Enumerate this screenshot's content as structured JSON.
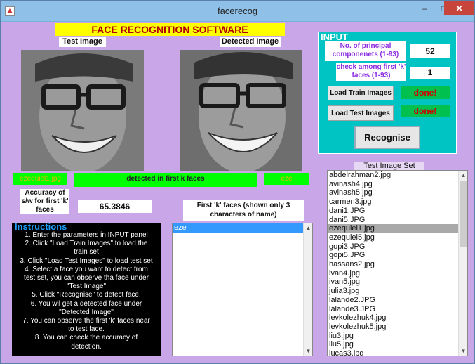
{
  "window": {
    "title": "facerecog"
  },
  "banner": "FACE RECOGNITION SOFTWARE",
  "test_image_label": "Test Image",
  "detected_image_label": "Detected Image",
  "test_filename": "ezequiel1.jpg",
  "detected_status": "detected in first k faces",
  "detected_name": "eze",
  "accuracy": {
    "label": "Accuracy of s/w for first 'k' faces",
    "value": "65.3846"
  },
  "first_k": {
    "label": "First 'k' faces (shown only 3 characters of name)",
    "items": [
      "eze"
    ]
  },
  "input_panel": {
    "title": "INPUT",
    "principal_label": "No. of principal componenets (1-93)",
    "principal_value": "52",
    "k_label": "check among first 'k' faces (1-93)",
    "k_value": "1",
    "load_train": "Load Train Images",
    "load_train_status": "done!",
    "load_test": "Load Test Images",
    "load_test_status": "done!",
    "recognise": "Recognise"
  },
  "test_set": {
    "label": "Test Image Set",
    "items": [
      "abdelrahman2.jpg",
      "avinash4.jpg",
      "avinash5.jpg",
      "carmen3.jpg",
      "dani1.JPG",
      "dani5.JPG",
      "ezequiel1.jpg",
      "ezequiel5.jpg",
      "gopi3.JPG",
      "gopi5.JPG",
      "hassans2.jpg",
      "ivan4.jpg",
      "ivan5.jpg",
      "julia3.jpg",
      "lalande2.JPG",
      "lalande3.JPG",
      "levkolezhuk4.jpg",
      "levkolezhuk5.jpg",
      "liu3.jpg",
      "liu5.jpg",
      "lucas3.jpg"
    ],
    "selected_index": 6
  },
  "instructions": {
    "title": "Instructions",
    "lines": [
      "1. Enter the parameters in INPUT panel",
      "2. Click \"Load Train Images\" to load the",
      "train set",
      "3. Click \"Load Test Images\" to load test set",
      "4. Select a face you want to detect from",
      "test set, you can observe tha face under",
      "\"Test Image\"",
      "5. Click \"Recognise\" to detect face.",
      "6. You wil get a detected face  under",
      "\"Detected Image\"",
      "7.  You can observe the first 'k' faces near",
      "to test face.",
      "8. You can check the accuracy of",
      "detection."
    ]
  }
}
